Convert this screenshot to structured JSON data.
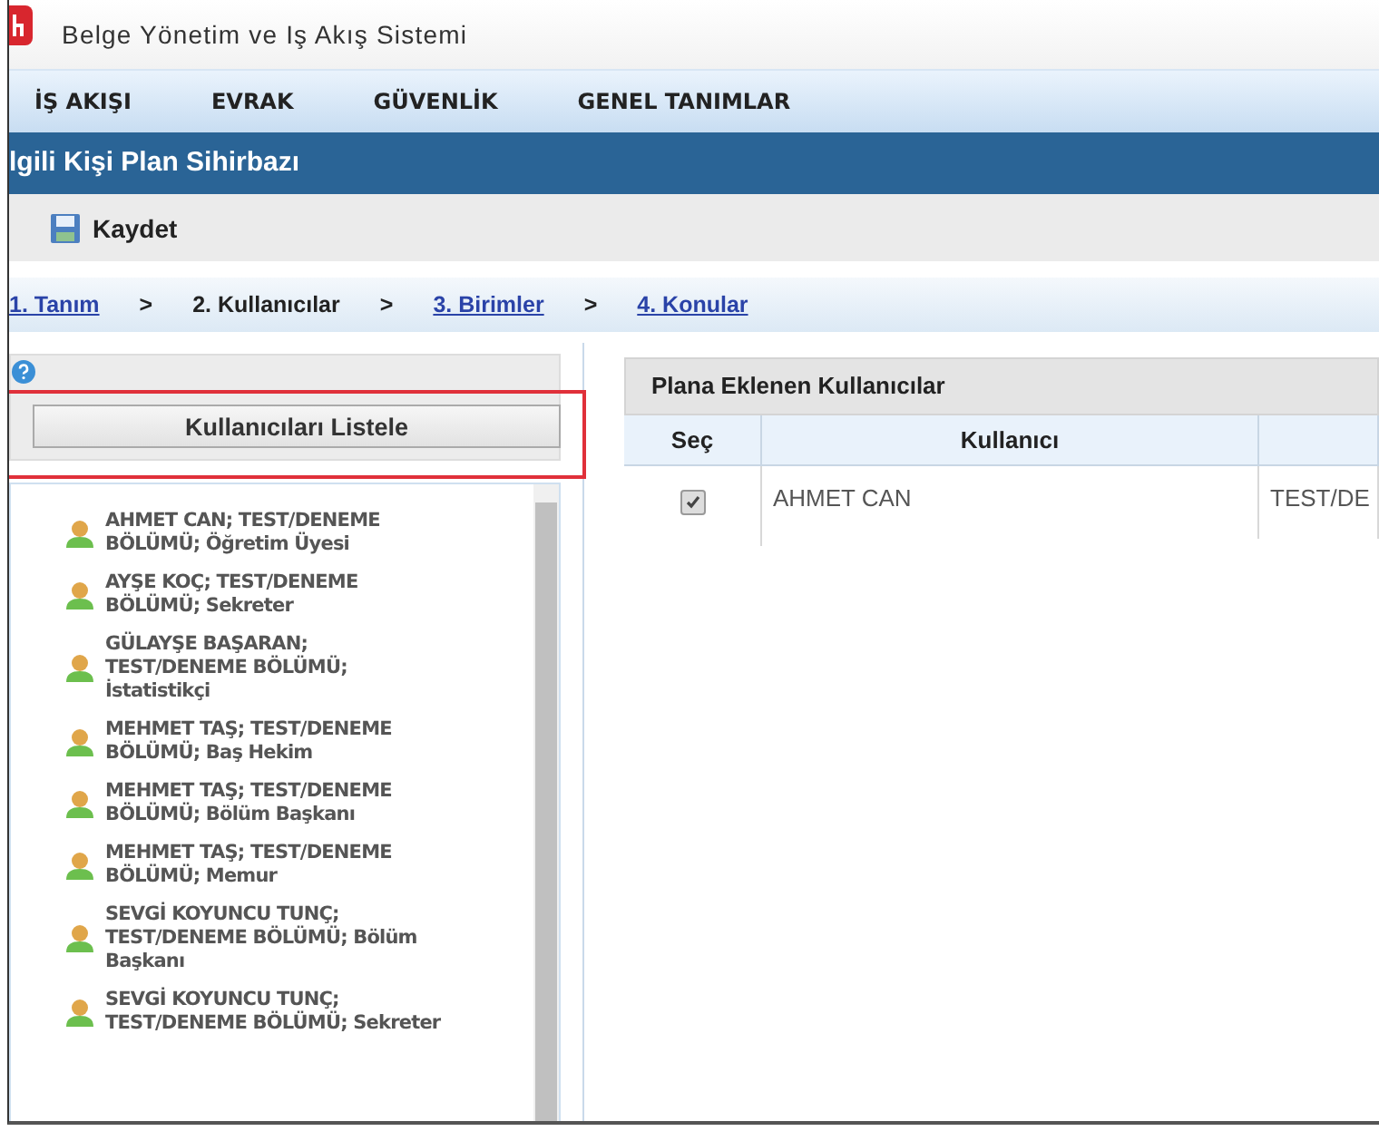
{
  "header": {
    "title": "Belge Yönetim ve Iş Akış Sistemi"
  },
  "menu": [
    {
      "label": "İŞ AKIŞI"
    },
    {
      "label": "EVRAK"
    },
    {
      "label": "GÜVENLİK"
    },
    {
      "label": "GENEL TANIMLAR"
    }
  ],
  "page_title": "lgili Kişi Plan Sihirbazı",
  "toolbar": {
    "save": "Kaydet"
  },
  "steps": [
    {
      "label": "1. Tanım",
      "selected": false
    },
    {
      "label": "2. Kullanıcılar",
      "selected": true
    },
    {
      "label": "3. Birimler",
      "selected": false
    },
    {
      "label": "4. Konular",
      "selected": false
    }
  ],
  "step_separator": ">",
  "left_panel": {
    "list_button": "Kullanıcıları Listele",
    "highlighted": true,
    "users": [
      "AHMET CAN; TEST/DENEME BÖLÜMÜ; Öğretim Üyesi",
      "AYŞE KOÇ; TEST/DENEME BÖLÜMÜ; Sekreter",
      "GÜLAYŞE BAŞARAN; TEST/DENEME BÖLÜMÜ; İstatistikçi",
      "MEHMET TAŞ; TEST/DENEME BÖLÜMÜ; Baş Hekim",
      "MEHMET TAŞ; TEST/DENEME BÖLÜMÜ; Bölüm Başkanı",
      "MEHMET TAŞ; TEST/DENEME BÖLÜMÜ; Memur",
      "SEVGİ KOYUNCU TUNÇ; TEST/DENEME BÖLÜMÜ; Bölüm Başkanı",
      "SEVGİ KOYUNCU TUNÇ; TEST/DENEME BÖLÜMÜ; Sekreter"
    ]
  },
  "table": {
    "title": "Plana Eklenen Kullanıcılar",
    "columns": [
      "Seç",
      "Kullanıcı"
    ],
    "rows": [
      {
        "checked": true,
        "user": "AHMET CAN",
        "column_3": "TEST/DE"
      }
    ]
  }
}
